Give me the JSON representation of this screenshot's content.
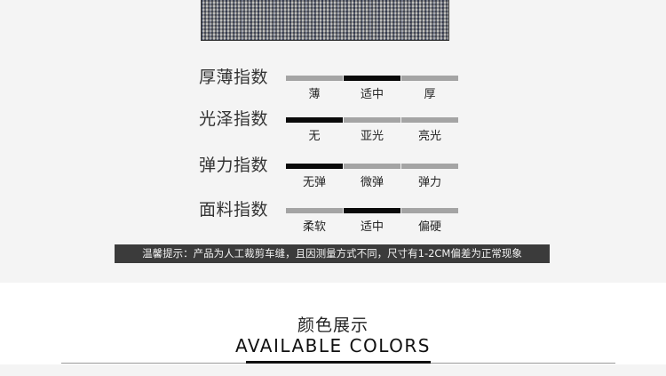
{
  "ratings": [
    {
      "label": "厚薄指数",
      "options": [
        "薄",
        "适中",
        "厚"
      ],
      "selected": 1
    },
    {
      "label": "光泽指数",
      "options": [
        "无",
        "亚光",
        "亮光"
      ],
      "selected": 0
    },
    {
      "label": "弹力指数",
      "options": [
        "无弹",
        "微弹",
        "弹力"
      ],
      "selected": 0
    },
    {
      "label": "面料指数",
      "options": [
        "柔软",
        "适中",
        "偏硬"
      ],
      "selected": 1
    }
  ],
  "notice": "温馨提示：产品为人工裁剪车缝，且因测量方式不同，尺寸有1-2CM偏差为正常现象",
  "section": {
    "title_cn": "颜色展示",
    "title_en": "AVAILABLE COLORS"
  },
  "colors": {
    "active_bar": "#0a0a0a",
    "inactive_bar": "#a4a4a4",
    "notice_bg": "#3b3b3b",
    "panel_bg": "#f4f4f4"
  }
}
